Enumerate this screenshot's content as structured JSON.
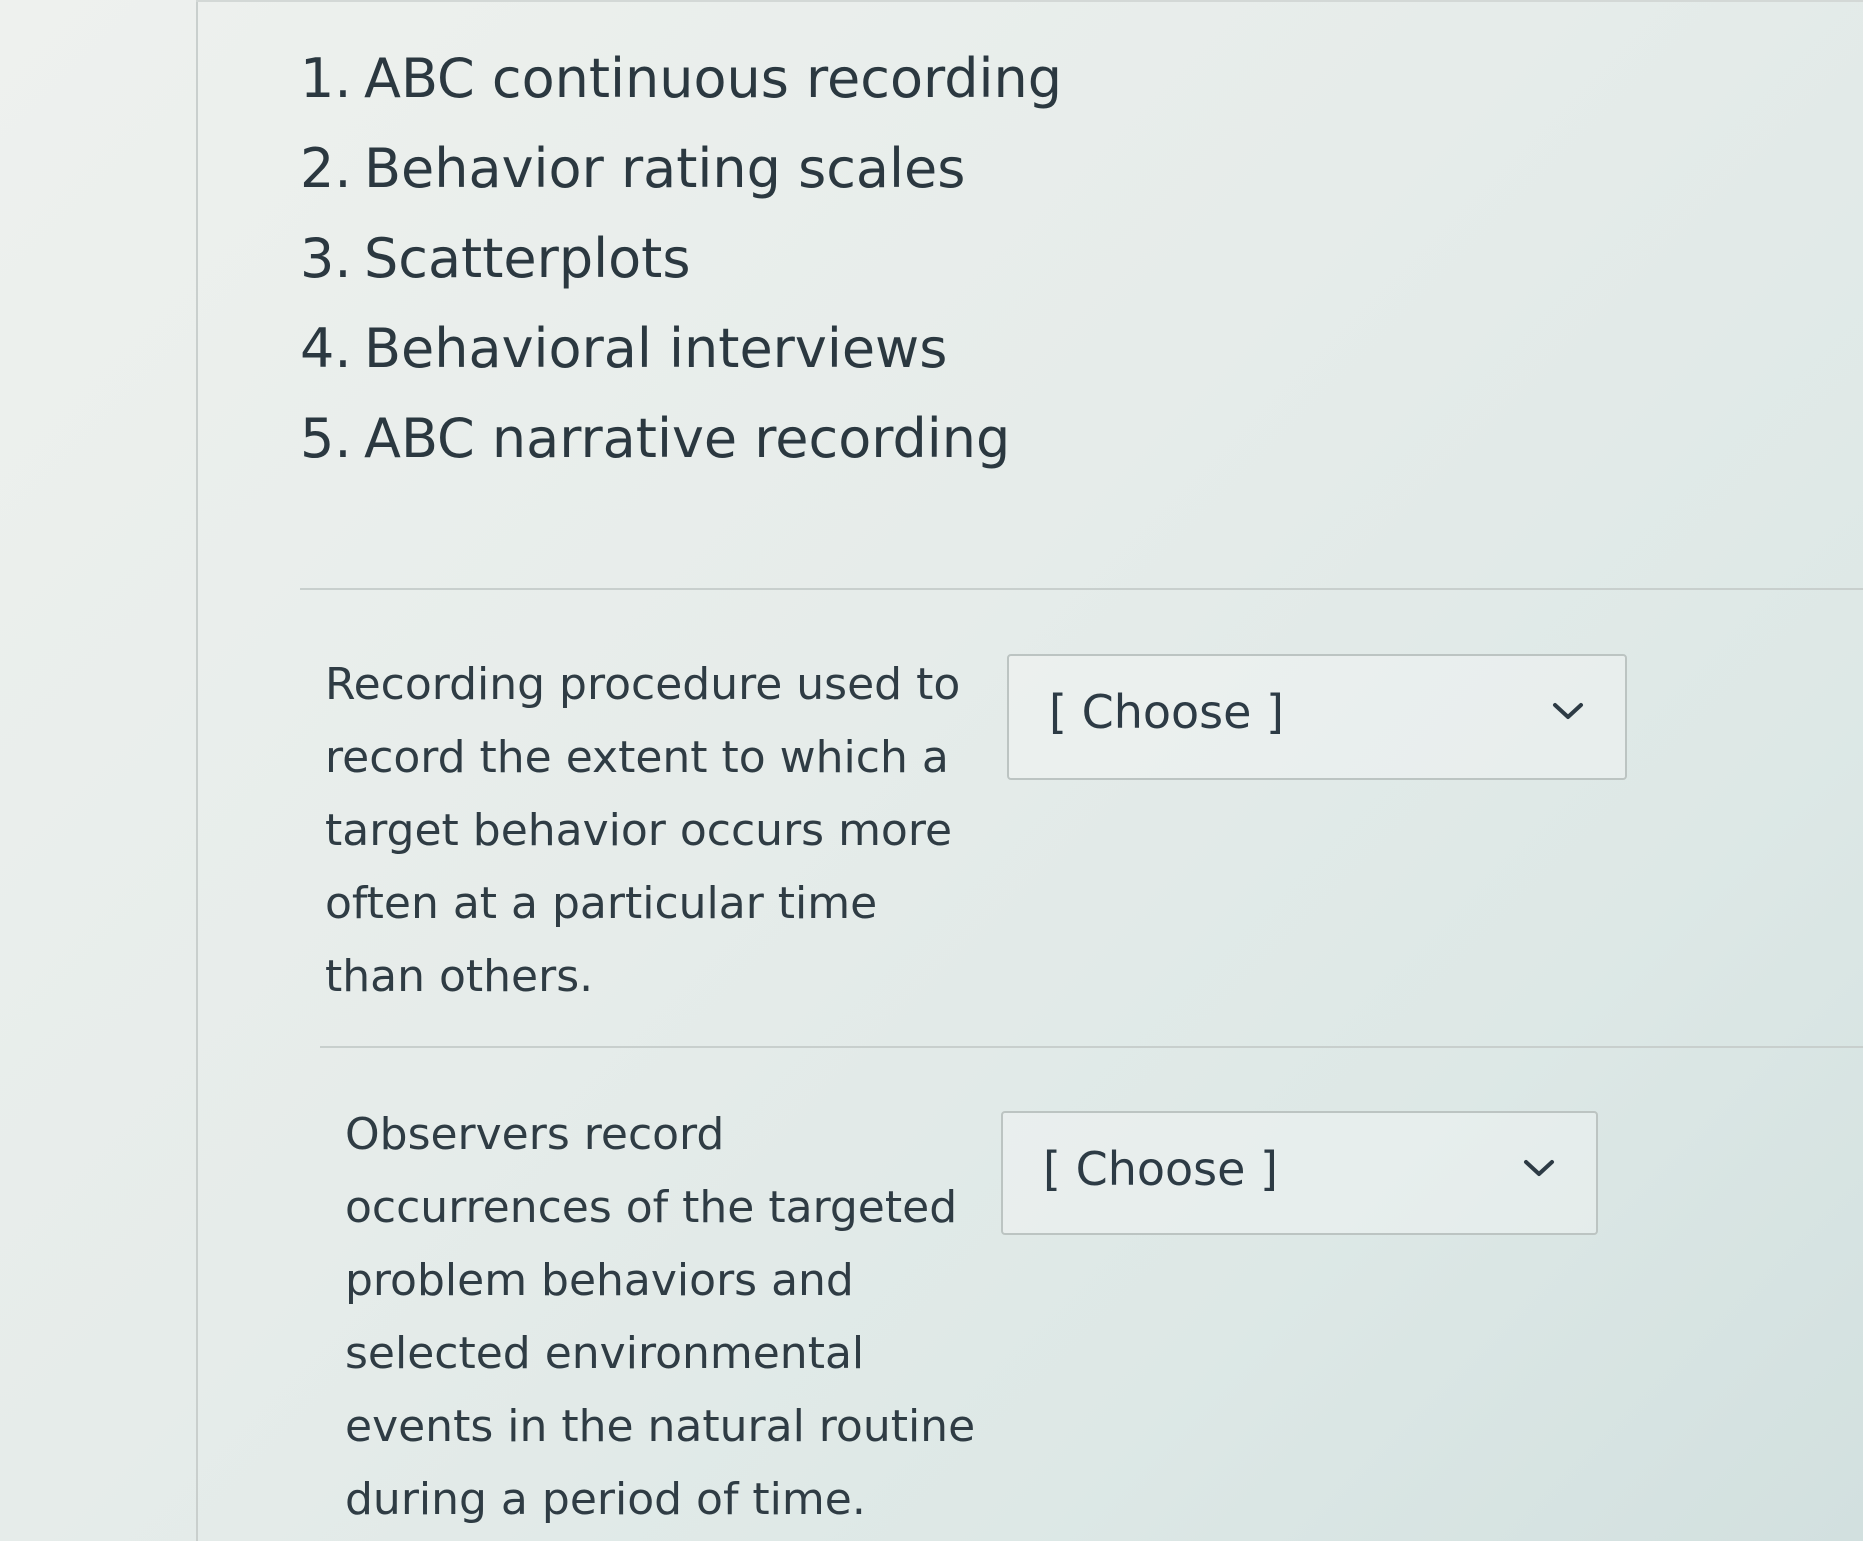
{
  "answer_bank": {
    "items": [
      {
        "number": "1.",
        "label": "ABC continuous recording"
      },
      {
        "number": "2.",
        "label": "Behavior rating scales"
      },
      {
        "number": "3.",
        "label": "Scatterplots"
      },
      {
        "number": "4.",
        "label": "Behavioral interviews"
      },
      {
        "number": "5.",
        "label": "ABC narrative recording"
      }
    ]
  },
  "questions": [
    {
      "prompt": "Recording procedure used to record the extent to which a target behavior occurs more often at a particular time than others.",
      "select_value": "[ Choose ]"
    },
    {
      "prompt": "Observers record occurrences of the targeted problem behaviors and selected environmental events in the natural routine during a period of time.",
      "select_value": "[ Choose ]"
    }
  ],
  "icons": {
    "dropdown": "chevron-down-icon"
  },
  "colors": {
    "text": "#2d3b45",
    "border": "#bcc4c2"
  }
}
